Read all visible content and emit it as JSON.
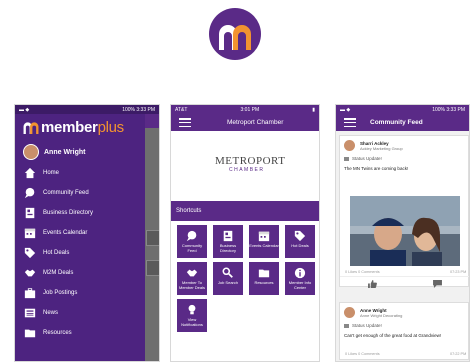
{
  "phone1": {
    "status": {
      "left": "▬ ◆",
      "right": "100% 3:33 PM"
    },
    "brand": {
      "member": "member",
      "plus": "plus"
    },
    "user_name": "Anne Wright",
    "menu": [
      {
        "label": "Home",
        "icon": "home-icon"
      },
      {
        "label": "Community Feed",
        "icon": "chat-icon"
      },
      {
        "label": "Business Directory",
        "icon": "directory-icon"
      },
      {
        "label": "Events Calendar",
        "icon": "calendar-icon"
      },
      {
        "label": "Hot Deals",
        "icon": "tag-icon"
      },
      {
        "label": "M2M Deals",
        "icon": "handshake-icon"
      },
      {
        "label": "Job Postings",
        "icon": "briefcase-icon"
      },
      {
        "label": "News",
        "icon": "newspaper-icon"
      },
      {
        "label": "Resources",
        "icon": "folder-icon"
      }
    ]
  },
  "phone2": {
    "status": {
      "left": "AT&T",
      "center": "3:01 PM",
      "right": "▮"
    },
    "title": "Metroport Chamber",
    "logo": {
      "big": "METROPORT",
      "small": "CHAMBER"
    },
    "shortcuts_label": "Shortcuts",
    "tiles": [
      {
        "label": "Community Feed",
        "icon": "chat-icon"
      },
      {
        "label": "Business Directory",
        "icon": "directory-icon"
      },
      {
        "label": "Events Calendar",
        "icon": "calendar-icon"
      },
      {
        "label": "Hot Deals",
        "icon": "tag-icon"
      },
      {
        "label": "Member To Member Deals",
        "icon": "handshake-icon"
      },
      {
        "label": "Job Search",
        "icon": "job-search-icon"
      },
      {
        "label": "Resources",
        "icon": "folder-icon"
      },
      {
        "label": "Member Info Center",
        "icon": "info-icon"
      },
      {
        "label": "View Notifications",
        "icon": "lightbulb-icon"
      }
    ]
  },
  "phone3": {
    "status": {
      "left": "▬ ◆",
      "right": "100% 3:33 PM"
    },
    "title": "Community Feed",
    "post1": {
      "name": "Sharri Ackley",
      "company": "Ackley Marketing Group",
      "status": "Status Update!",
      "message": "The MN Twins are coming back!",
      "meta": "0 Likes  0 Comments",
      "time": "07:23 PM"
    },
    "post2": {
      "name": "Anne Wright",
      "company": "Anne Wright Decorating",
      "status": "Status Update!",
      "message": "Can't get enough of the great food at Grandview!",
      "meta": "0 Likes  0 Comments",
      "time": "07:22 PM"
    }
  },
  "colors": {
    "brand_purple": "#5a2a87",
    "accent_orange": "#f29330"
  }
}
